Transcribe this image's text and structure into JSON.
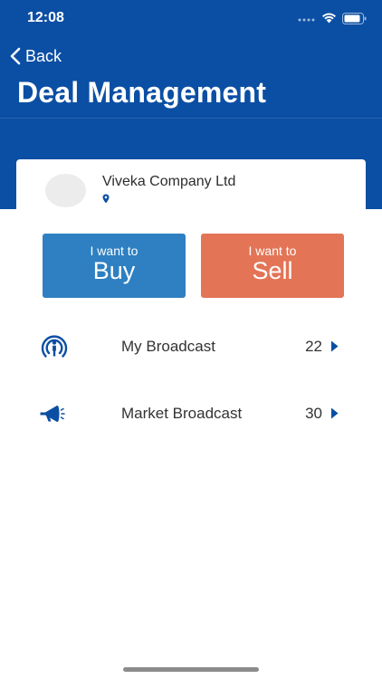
{
  "status_bar": {
    "time": "12:08"
  },
  "nav": {
    "back_label": "Back",
    "title": "Deal Management"
  },
  "company": {
    "name": "Viveka Company Ltd"
  },
  "actions": {
    "buy": {
      "caption": "I want to",
      "label": "Buy",
      "color": "#2e80c2"
    },
    "sell": {
      "caption": "I want to",
      "label": "Sell",
      "color": "#e37456"
    }
  },
  "list": [
    {
      "label": "My Broadcast",
      "count": "22",
      "icon": "broadcast-icon"
    },
    {
      "label": "Market Broadcast",
      "count": "30",
      "icon": "megaphone-icon"
    }
  ],
  "colors": {
    "header": "#0b4fa4",
    "accent": "#0b4fa4"
  }
}
